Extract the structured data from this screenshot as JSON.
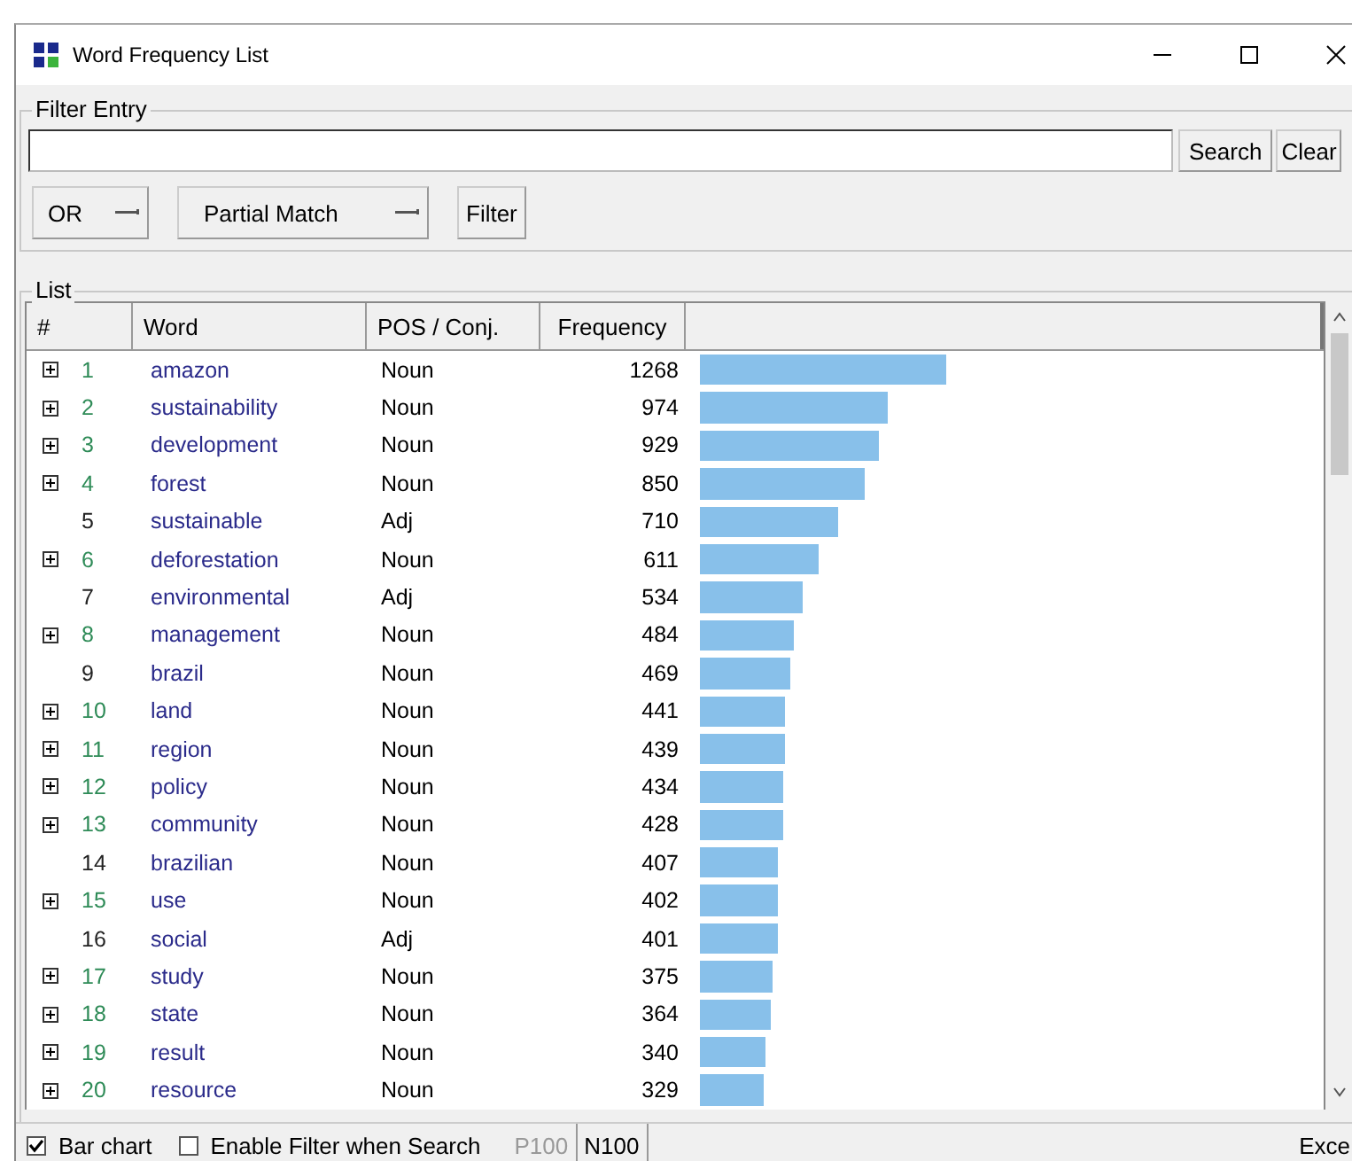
{
  "window": {
    "title": "Word Frequency List"
  },
  "filter_entry": {
    "title": "Filter Entry",
    "search_button": "Search",
    "clear_button": "Clear",
    "operator": "OR",
    "match_mode": "Partial Match",
    "filter_button": "Filter"
  },
  "list": {
    "title": "List",
    "columns": [
      "#",
      "Word",
      "POS / Conj.",
      "Frequency"
    ],
    "rows": [
      {
        "expandable": true,
        "number": "1",
        "word": "amazon",
        "pos": "Noun",
        "frequency": "1268"
      },
      {
        "expandable": true,
        "number": "2",
        "word": "sustainability",
        "pos": "Noun",
        "frequency": "974"
      },
      {
        "expandable": true,
        "number": "3",
        "word": "development",
        "pos": "Noun",
        "frequency": "929"
      },
      {
        "expandable": true,
        "number": "4",
        "word": "forest",
        "pos": "Noun",
        "frequency": "850"
      },
      {
        "expandable": false,
        "number": "5",
        "word": "sustainable",
        "pos": "Adj",
        "frequency": "710"
      },
      {
        "expandable": true,
        "number": "6",
        "word": "deforestation",
        "pos": "Noun",
        "frequency": "611"
      },
      {
        "expandable": false,
        "number": "7",
        "word": "environmental",
        "pos": "Adj",
        "frequency": "534"
      },
      {
        "expandable": true,
        "number": "8",
        "word": "management",
        "pos": "Noun",
        "frequency": "484"
      },
      {
        "expandable": false,
        "number": "9",
        "word": "brazil",
        "pos": "Noun",
        "frequency": "469"
      },
      {
        "expandable": true,
        "number": "10",
        "word": "land",
        "pos": "Noun",
        "frequency": "441"
      },
      {
        "expandable": true,
        "number": "11",
        "word": "region",
        "pos": "Noun",
        "frequency": "439"
      },
      {
        "expandable": true,
        "number": "12",
        "word": "policy",
        "pos": "Noun",
        "frequency": "434"
      },
      {
        "expandable": true,
        "number": "13",
        "word": "community",
        "pos": "Noun",
        "frequency": "428"
      },
      {
        "expandable": false,
        "number": "14",
        "word": "brazilian",
        "pos": "Noun",
        "frequency": "407"
      },
      {
        "expandable": true,
        "number": "15",
        "word": "use",
        "pos": "Noun",
        "frequency": "402"
      },
      {
        "expandable": false,
        "number": "16",
        "word": "social",
        "pos": "Adj",
        "frequency": "401"
      },
      {
        "expandable": true,
        "number": "17",
        "word": "study",
        "pos": "Noun",
        "frequency": "375"
      },
      {
        "expandable": true,
        "number": "18",
        "word": "state",
        "pos": "Noun",
        "frequency": "364"
      },
      {
        "expandable": true,
        "number": "19",
        "word": "result",
        "pos": "Noun",
        "frequency": "340"
      },
      {
        "expandable": true,
        "number": "20",
        "word": "resource",
        "pos": "Noun",
        "frequency": "329"
      }
    ]
  },
  "status_bar": {
    "bar_chart": {
      "label": "Bar chart",
      "checked": true
    },
    "enable_filter": {
      "label": "Enable Filter when Search",
      "checked": false
    },
    "p100": {
      "label": "P100",
      "disabled": true
    },
    "n100": {
      "label": "N100",
      "disabled": false
    },
    "export_button": "Exce"
  }
}
